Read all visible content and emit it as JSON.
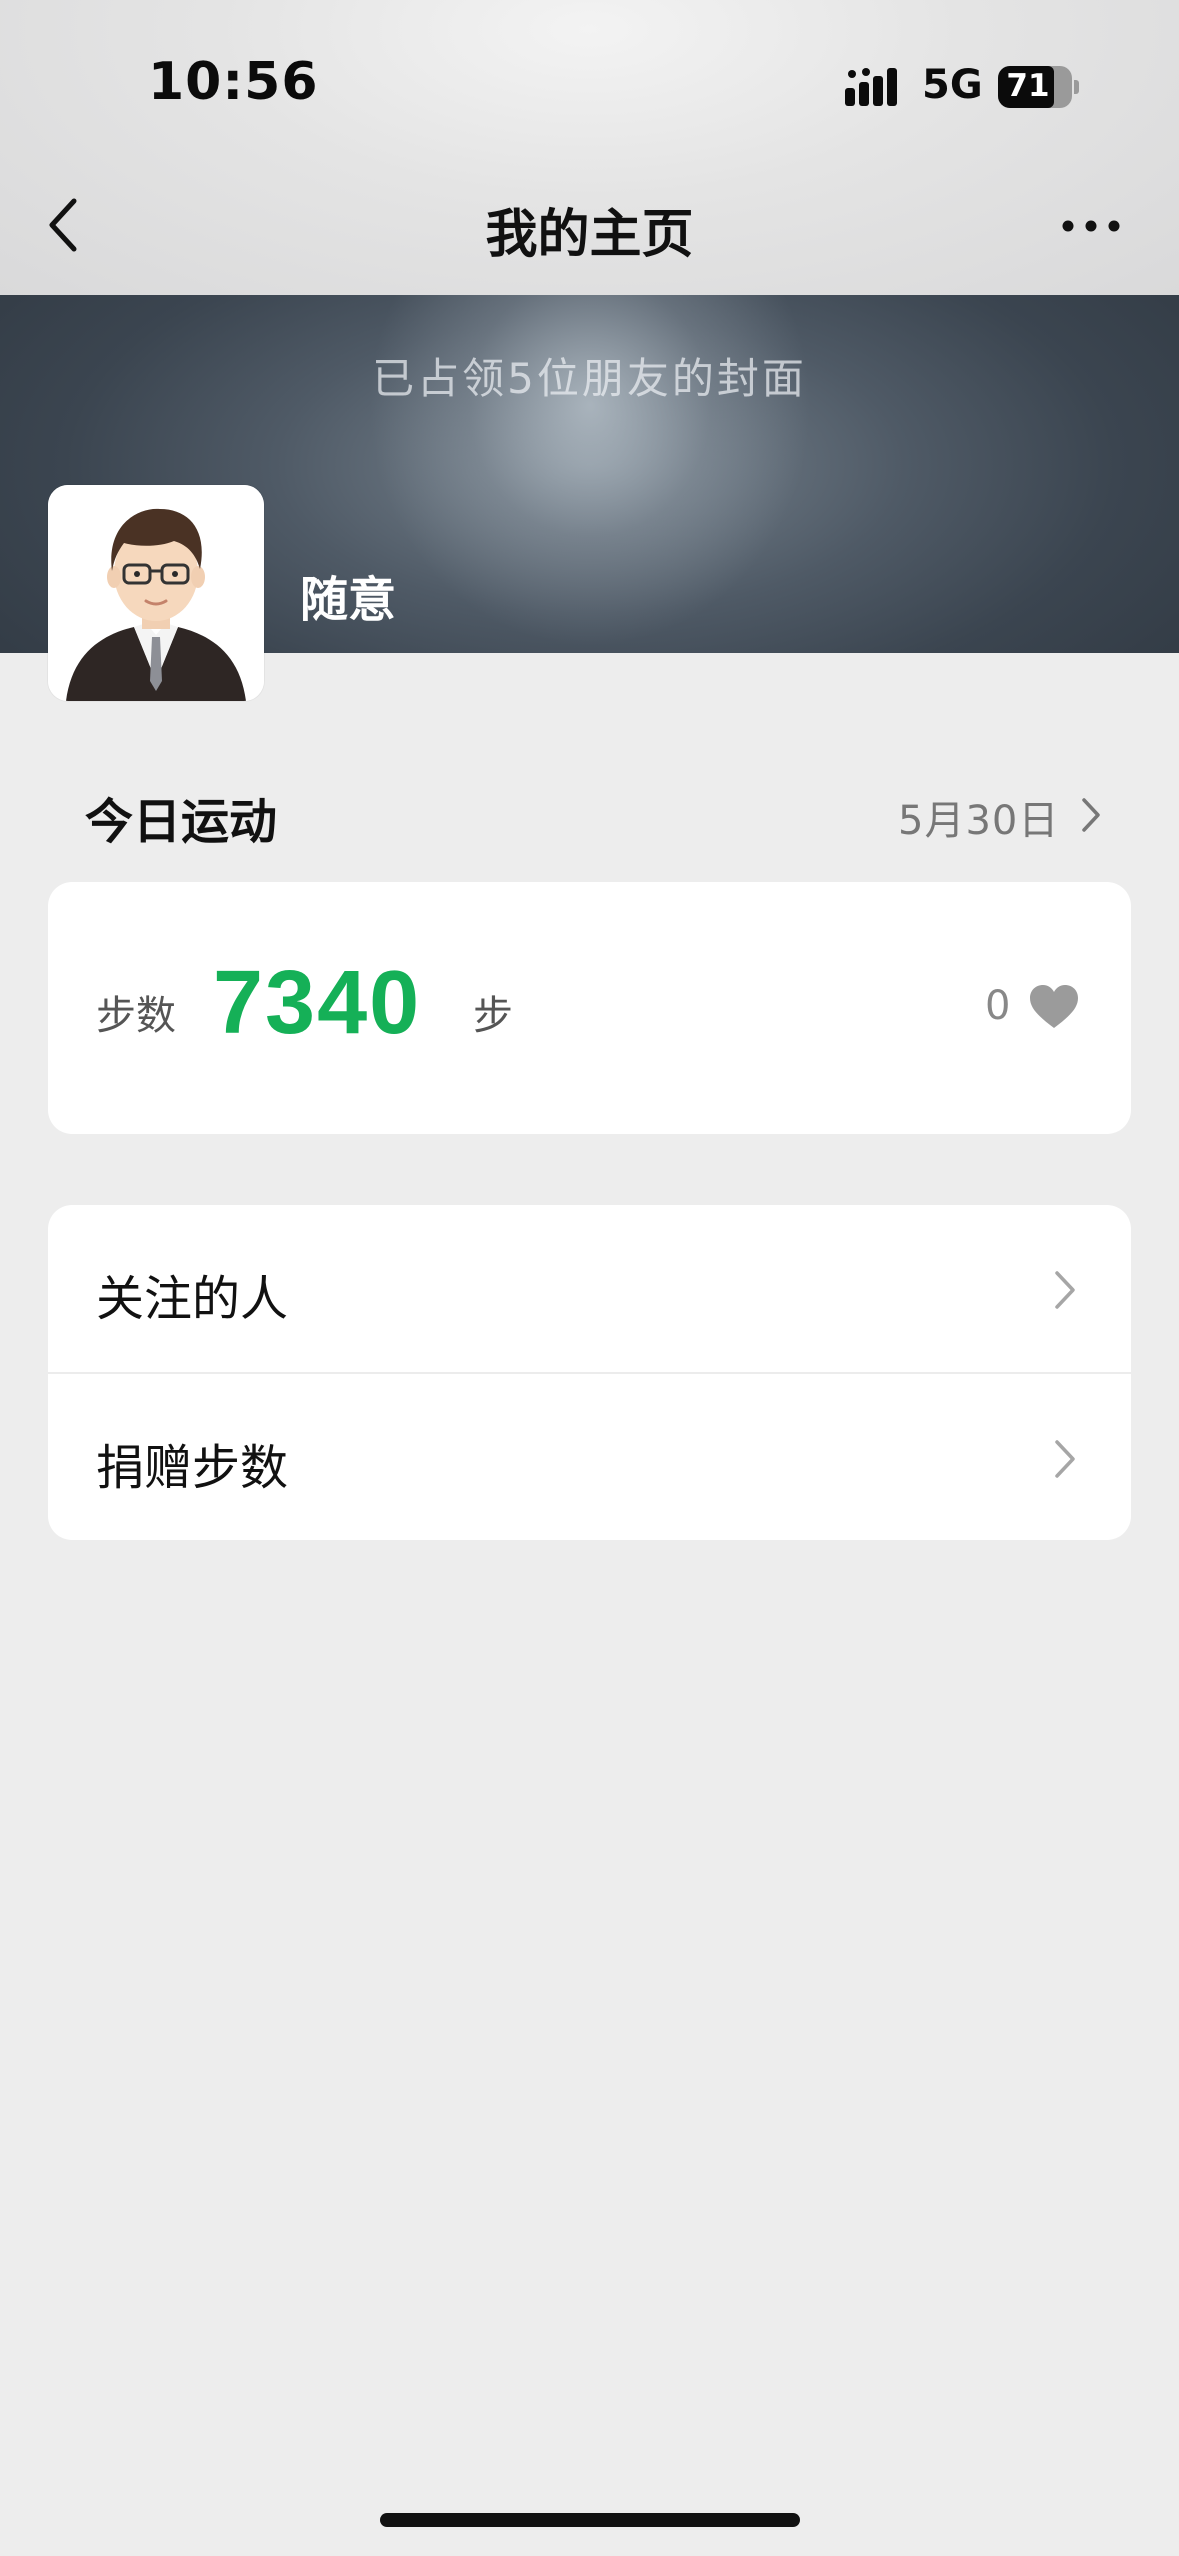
{
  "status_bar": {
    "time": "10:56",
    "network": "5G",
    "battery": "71",
    "signal_icon": "signal-bars-icon"
  },
  "nav": {
    "title": "我的主页",
    "back_icon": "chevron-left-icon",
    "more_icon": "ellipsis-icon"
  },
  "cover": {
    "note": "已占领5位朋友的封面"
  },
  "profile": {
    "nickname": "随意",
    "avatar_icon": "cartoon-avatar"
  },
  "today": {
    "title": "今日运动",
    "date": "5月30日"
  },
  "steps_card": {
    "label": "步数",
    "value": "7340",
    "unit": "步",
    "likes": "0",
    "heart_icon": "heart-icon",
    "value_color": "#15b057"
  },
  "menu": {
    "items": [
      {
        "label": "关注的人"
      },
      {
        "label": "捐赠步数"
      }
    ]
  }
}
